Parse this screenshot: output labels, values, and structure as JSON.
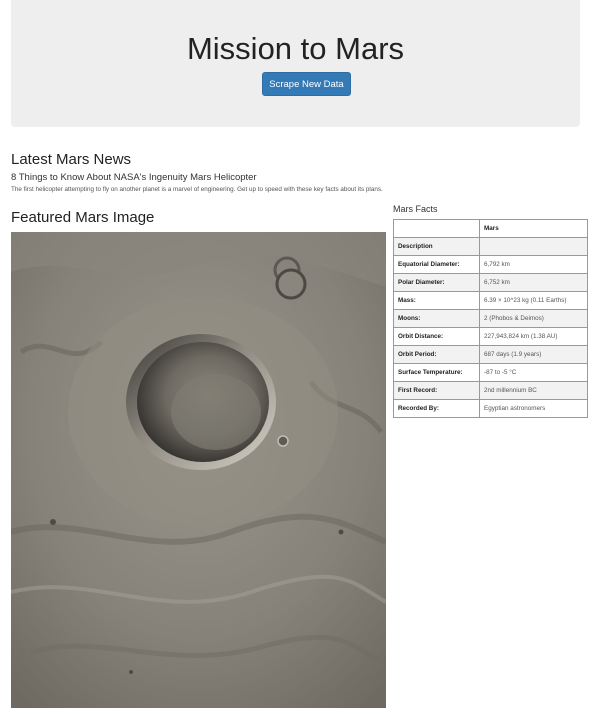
{
  "header": {
    "title": "Mission to Mars",
    "scrape_button": "Scrape New Data"
  },
  "news": {
    "heading": "Latest Mars News",
    "title": "8 Things to Know About NASA's Ingenuity Mars Helicopter",
    "teaser": "The first helicopter attempting to fly on another planet is a marvel of engineering. Get up to speed with these key facts about its plans."
  },
  "featured": {
    "heading": "Featured Mars Image"
  },
  "facts": {
    "heading": "Mars Facts",
    "column_header": "Mars",
    "rows": [
      {
        "label": "Description",
        "value": ""
      },
      {
        "label": "Equatorial Diameter:",
        "value": "6,792 km"
      },
      {
        "label": "Polar Diameter:",
        "value": "6,752 km"
      },
      {
        "label": "Mass:",
        "value": "6.39 × 10^23 kg (0.11 Earths)"
      },
      {
        "label": "Moons:",
        "value": "2 (Phobos & Deimos)"
      },
      {
        "label": "Orbit Distance:",
        "value": "227,943,824 km (1.38 AU)"
      },
      {
        "label": "Orbit Period:",
        "value": "687 days (1.9 years)"
      },
      {
        "label": "Surface Temperature:",
        "value": "-87 to -5 °C"
      },
      {
        "label": "First Record:",
        "value": "2nd millennium BC"
      },
      {
        "label": "Recorded By:",
        "value": "Egyptian astronomers"
      }
    ]
  }
}
